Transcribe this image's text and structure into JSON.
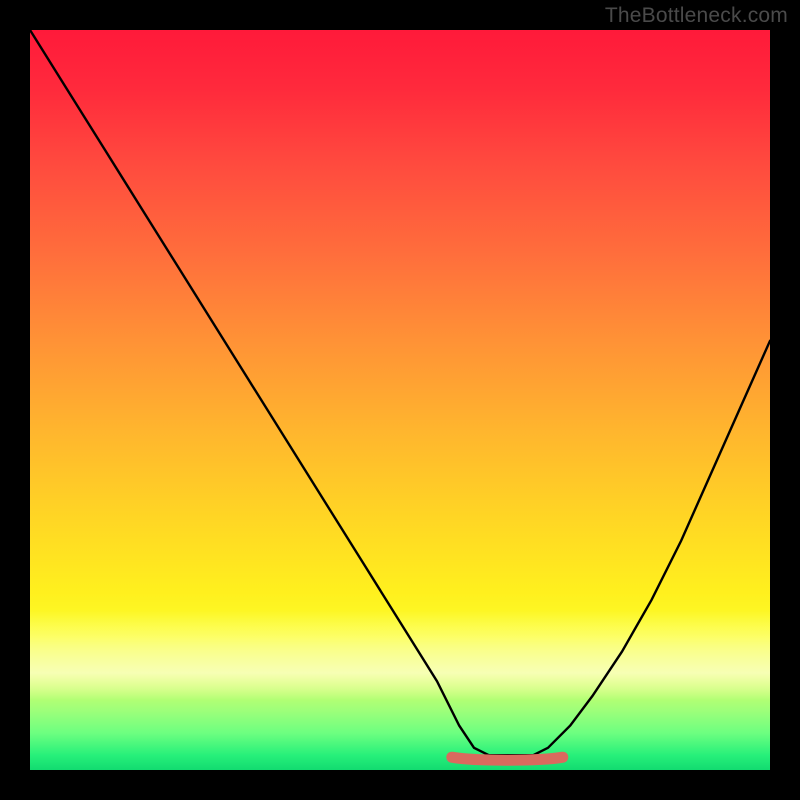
{
  "watermark": "TheBottleneck.com",
  "chart_data": {
    "type": "line",
    "title": "",
    "xlabel": "",
    "ylabel": "",
    "xlim": [
      0,
      100
    ],
    "ylim": [
      0,
      100
    ],
    "series": [
      {
        "name": "bottleneck-curve",
        "x": [
          0,
          5,
          10,
          15,
          20,
          25,
          30,
          35,
          40,
          45,
          50,
          55,
          58,
          60,
          62,
          65,
          68,
          70,
          73,
          76,
          80,
          84,
          88,
          92,
          96,
          100
        ],
        "values": [
          100,
          92,
          84,
          76,
          68,
          60,
          52,
          44,
          36,
          28,
          20,
          12,
          6,
          3,
          2,
          2,
          2,
          3,
          6,
          10,
          16,
          23,
          31,
          40,
          49,
          58
        ]
      }
    ],
    "accent_segment": {
      "name": "green-zone-marker",
      "color": "#d96a5e",
      "x_start": 57,
      "x_end": 72,
      "y": 2
    },
    "background_gradient": {
      "top": "#ff1a3a",
      "mid_upper": "#ff9236",
      "mid": "#ffd624",
      "mid_lower": "#fbff2a",
      "bottom": "#12db70"
    }
  }
}
